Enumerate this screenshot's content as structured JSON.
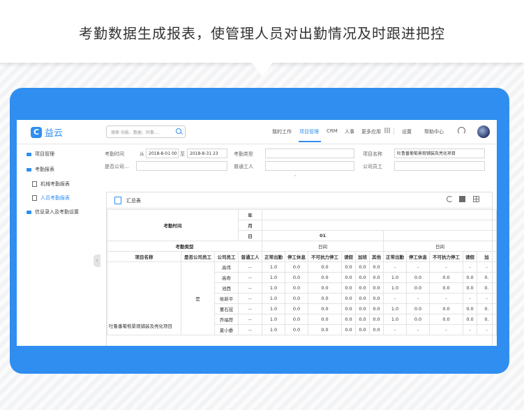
{
  "banner": {
    "title": "考勤数据生成报表，使管理人员对出勤情况及时跟进把控"
  },
  "topbar": {
    "logo_mark": "C",
    "logo_text": "益云",
    "search_placeholder": "搜索 功能、数据、同事....",
    "nav": [
      "我的工作",
      "项目管理",
      "CRM",
      "人事",
      "更多应用"
    ],
    "right": [
      "设置",
      "帮助中心"
    ]
  },
  "sidebar": {
    "items": [
      {
        "label": "项目管理",
        "icon": "folder-icon"
      },
      {
        "label": "考勤报表",
        "icon": "folder-open-icon"
      },
      {
        "label": "机械考勤报表",
        "icon": "document-icon"
      },
      {
        "label": "人员考勤报表",
        "icon": "document-icon"
      },
      {
        "label": "信息录入及考勤设置",
        "icon": "folder-icon"
      }
    ]
  },
  "filters": {
    "time_label": "考勤时间",
    "from_label": "从",
    "from_value": "2018-8-01 00",
    "to_label": "至",
    "to_value": "2018-8-31 23",
    "type_label": "考勤类型",
    "project_label": "项目名称",
    "project_value": "吐鲁番葡萄景观铺装及亮化项目",
    "is_company_label": "是否公司...",
    "ordinary_label": "普通工人",
    "staff_label": "公司员工",
    "expand_icon": "chevron-up-icon"
  },
  "panel": {
    "title": "汇总表"
  },
  "table": {
    "year": "年",
    "month": "月",
    "day": "日",
    "time_label": "考勤时间",
    "day_value": "01",
    "type_label": "考勤类型",
    "daily": "日间",
    "columns": [
      "项目名称",
      "是否公司员工",
      "公司员工",
      "普通工人",
      "正常出勤",
      "停工休息",
      "不可抗力停工",
      "请假",
      "加班",
      "其他",
      "正常出勤",
      "停工休息",
      "不可抗力停工",
      "请假",
      "加"
    ],
    "project_name": "吐鲁番葡萄景观铺装及亮化项目",
    "is_company": "是",
    "rows": [
      {
        "staff": "高伟",
        "worker": "--",
        "a": [
          "1.0",
          "0.0",
          "0.0",
          "0.0",
          "0.0",
          "0.0"
        ],
        "b": [
          "-",
          "-",
          "-",
          "-",
          "-"
        ]
      },
      {
        "staff": "高奇",
        "worker": "--",
        "a": [
          "1.0",
          "0.0",
          "0.0",
          "0.0",
          "0.0",
          "0.0"
        ],
        "b": [
          "1.0",
          "0.0",
          "0.0",
          "0.0",
          "0."
        ]
      },
      {
        "staff": "池西",
        "worker": "--",
        "a": [
          "1.0",
          "0.0",
          "0.0",
          "0.0",
          "0.0",
          "0.0"
        ],
        "b": [
          "1.0",
          "0.0",
          "0.0",
          "0.0",
          "0."
        ]
      },
      {
        "staff": "侯新平",
        "worker": "--",
        "a": [
          "1.0",
          "0.0",
          "0.0",
          "0.0",
          "0.0",
          "0.0"
        ],
        "b": [
          "-",
          "-",
          "-",
          "-",
          "-"
        ]
      },
      {
        "staff": "董石昆",
        "worker": "--",
        "a": [
          "1.0",
          "0.0",
          "0.0",
          "0.0",
          "0.0",
          "0.0"
        ],
        "b": [
          "1.0",
          "0.0",
          "0.0",
          "0.0",
          "0."
        ]
      },
      {
        "staff": "乔福荐",
        "worker": "--",
        "a": [
          "1.0",
          "0.0",
          "0.0",
          "0.0",
          "0.0",
          "0.0"
        ],
        "b": [
          "1.0",
          "0.0",
          "0.0",
          "0.0",
          "0."
        ]
      },
      {
        "staff": "夏小委",
        "worker": "--",
        "a": [
          "1.0",
          "0.0",
          "0.0",
          "0.0",
          "0.0",
          "0.0"
        ],
        "b": [
          "-",
          "-",
          "-",
          "-",
          "-"
        ]
      }
    ]
  }
}
